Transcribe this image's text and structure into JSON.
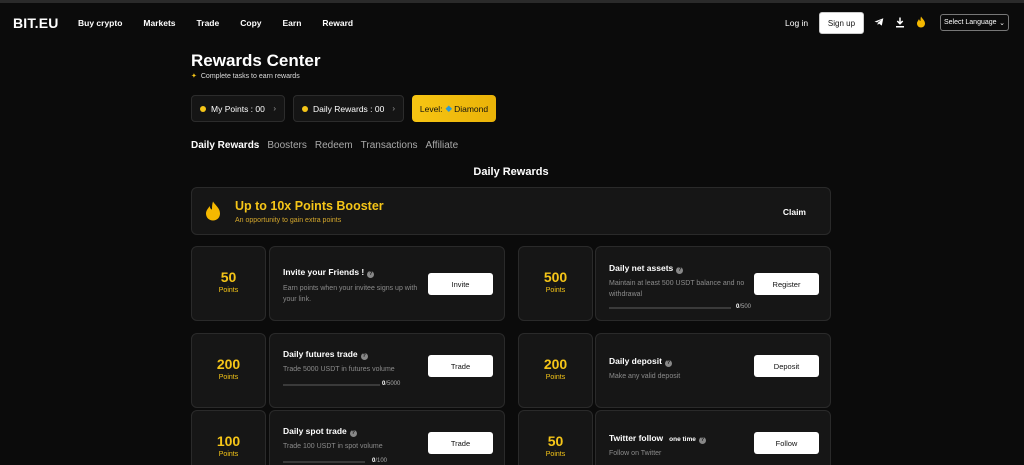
{
  "header": {
    "logo": "BIT.EU",
    "nav": [
      "Buy crypto",
      "Markets",
      "Trade",
      "Copy",
      "Earn",
      "Reward"
    ],
    "login": "Log in",
    "signup": "Sign up",
    "icons": [
      "telegram-icon",
      "download-icon",
      "flame-icon"
    ],
    "language": "Select Language"
  },
  "page": {
    "title": "Rewards Center",
    "subtitle": "Complete tasks to earn rewards"
  },
  "summary": {
    "my_points": "My Points : 00",
    "daily_rewards": "Daily Rewards : 00",
    "level_prefix": "Level:",
    "level_value": "Diamond"
  },
  "tabs": [
    "Daily Rewards",
    "Boosters",
    "Redeem",
    "Transactions",
    "Affiliate"
  ],
  "section_title": "Daily Rewards",
  "booster": {
    "title": "Up to 10x Points Booster",
    "subtitle": "An opportunity to gain extra points",
    "claim": "Claim"
  },
  "points_label": "Points",
  "tasks": [
    {
      "points": "50",
      "title": "Invite your Friends !",
      "tag": "",
      "desc": "Earn points when your invitee signs up with your link.",
      "button": "Invite",
      "progress_done": "",
      "progress_total": ""
    },
    {
      "points": "500",
      "title": "Daily net assets",
      "tag": "",
      "desc": "Maintain at least 500 USDT balance and no withdrawal",
      "button": "Register",
      "progress_done": "0",
      "progress_total": "/500"
    },
    {
      "points": "200",
      "title": "Daily futures trade",
      "tag": "",
      "desc": "Trade 5000 USDT in futures volume",
      "button": "Trade",
      "progress_done": "0",
      "progress_total": "/5000"
    },
    {
      "points": "200",
      "title": "Daily deposit",
      "tag": "",
      "desc": "Make any valid deposit",
      "button": "Deposit",
      "progress_done": "",
      "progress_total": ""
    },
    {
      "points": "100",
      "title": "Daily spot trade",
      "tag": "",
      "desc": "Trade 100 USDT in spot volume",
      "button": "Trade",
      "progress_done": "0",
      "progress_total": "/100"
    },
    {
      "points": "50",
      "title": "Twitter follow",
      "tag": "one time",
      "desc": "Follow on Twitter",
      "button": "Follow",
      "progress_done": "",
      "progress_total": ""
    }
  ],
  "colors": {
    "accent": "#f5c518",
    "background": "#0b0b0b",
    "card": "#161616"
  }
}
